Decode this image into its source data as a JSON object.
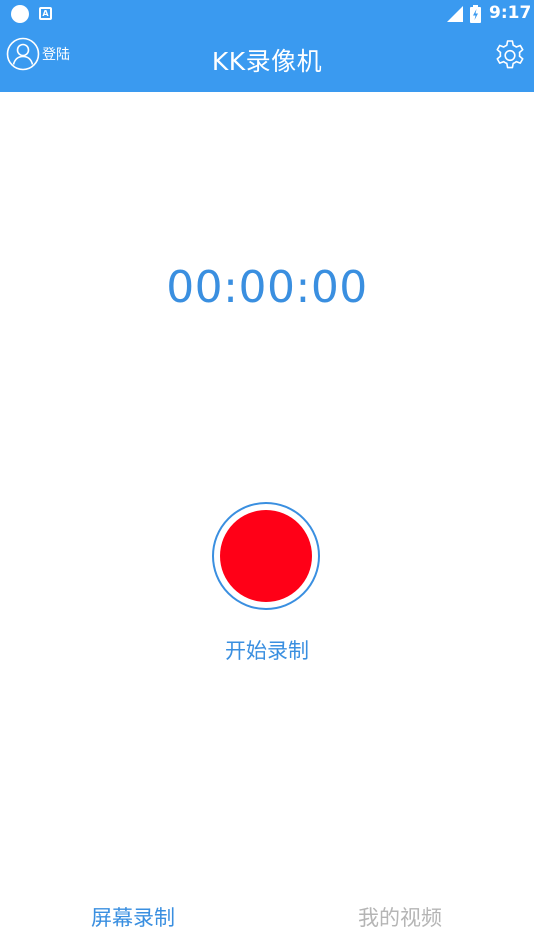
{
  "status_bar": {
    "time": "9:17",
    "notification_icon": "A"
  },
  "app_bar": {
    "login_label": "登陆",
    "title": "KK录像机"
  },
  "recorder": {
    "timer": "00:00:00",
    "start_label": "开始录制",
    "record_color": "#ff0017"
  },
  "tabs": [
    {
      "label": "屏幕录制",
      "active": true
    },
    {
      "label": "我的视频",
      "active": false
    }
  ],
  "colors": {
    "primary": "#3a9af0",
    "accent": "#3a8fe0",
    "inactive_tab": "#b5b5b5"
  },
  "icons": [
    "avatar-icon",
    "gear-icon",
    "signal-icon",
    "battery-icon",
    "record-icon"
  ]
}
